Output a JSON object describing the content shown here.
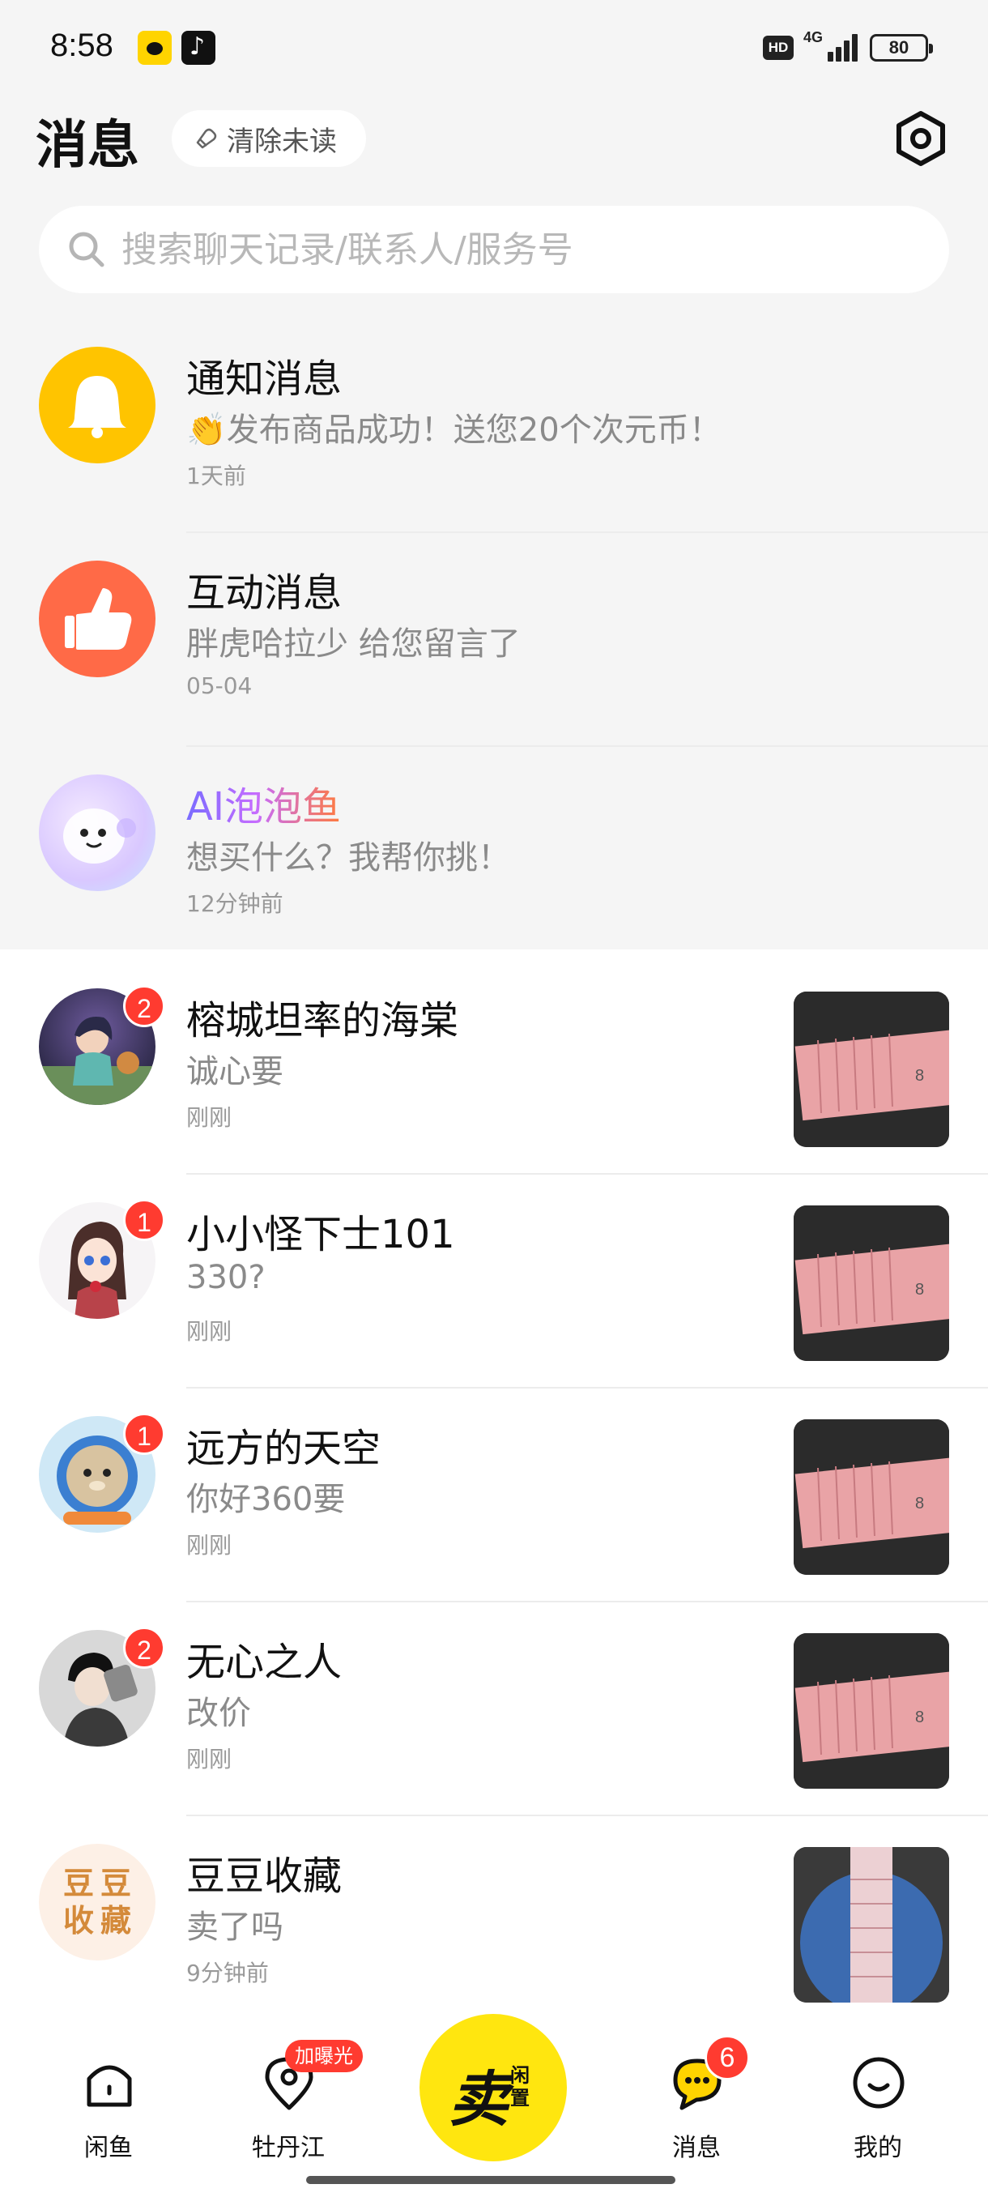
{
  "status_bar": {
    "time": "8:58",
    "hd": "HD",
    "network": "4G",
    "battery": "80"
  },
  "header": {
    "title": "消息",
    "clear_unread_label": "清除未读"
  },
  "search": {
    "placeholder": "搜索聊天记录/联系人/服务号"
  },
  "system_rows": [
    {
      "title": "通知消息",
      "preview": "👏发布商品成功！送您20个次元币！",
      "time": "1天前"
    },
    {
      "title": "互动消息",
      "preview": "胖虎哈拉少 给您留言了",
      "time": "05-04"
    },
    {
      "title": "AI泡泡鱼",
      "preview": "想买什么？我帮你挑！",
      "time": "12分钟前"
    }
  ],
  "chats": [
    {
      "name": "榕城坦率的海棠",
      "message": "诚心要",
      "time": "刚刚",
      "unread": "2"
    },
    {
      "name": "小小怪下士101",
      "message": "330?",
      "time": "刚刚",
      "unread": "1"
    },
    {
      "name": "远方的天空",
      "message": "你好360要",
      "time": "刚刚",
      "unread": "1"
    },
    {
      "name": "无心之人",
      "message": "改价",
      "time": "刚刚",
      "unread": "2"
    },
    {
      "name": "豆豆收藏",
      "message": "卖了吗",
      "time": "9分钟前",
      "unread": "",
      "avatar_text": [
        "豆",
        "豆",
        "收",
        "藏"
      ]
    }
  ],
  "bottom_nav": {
    "home_label": "闲鱼",
    "local_label": "牡丹江",
    "local_badge": "加曝光",
    "sell_main": "卖",
    "sell_sub": "闲置",
    "messages_label": "消息",
    "messages_badge": "6",
    "me_label": "我的"
  },
  "colors": {
    "accent_yellow": "#ffe60f",
    "badge_red": "#ff3b30",
    "notify_yellow": "#ffc400",
    "interact_orange": "#ff6a47"
  }
}
